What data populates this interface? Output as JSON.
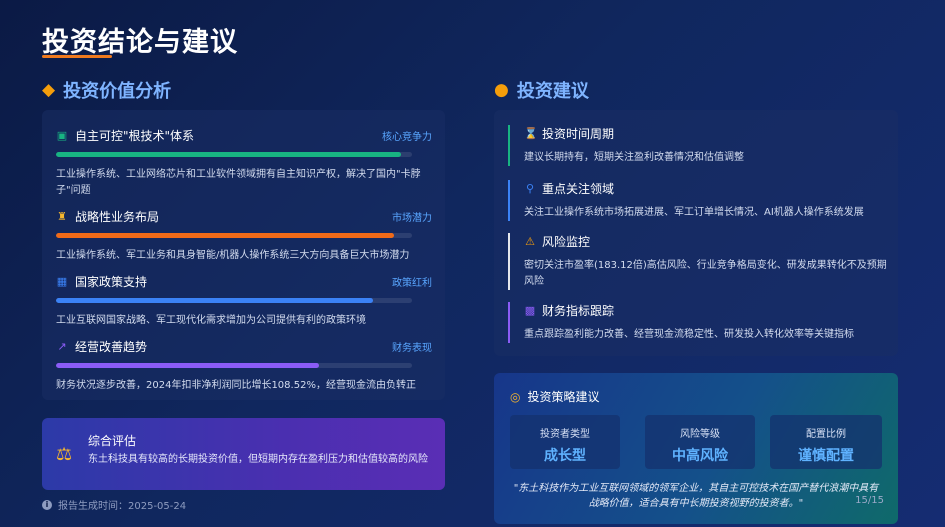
{
  "page": {
    "title": "投资结论与建议",
    "footer": {
      "label": "报告生成时间：",
      "date": "2025-05-24"
    },
    "page_number": "15/15"
  },
  "left": {
    "heading": "投资价值分析",
    "heading_icon": "gem-icon",
    "items": [
      {
        "icon": "chip-icon",
        "title": "自主可控\"根技术\"体系",
        "tag": "核心竞争力",
        "desc": "工业操作系统、工业网络芯片和工业软件领域拥有自主知识产权，解决了国内\"卡脖子\"问题",
        "color": "#18b482",
        "level": 0.97
      },
      {
        "icon": "chess-icon",
        "title": "战略性业务布局",
        "tag": "市场潜力",
        "desc": "工业操作系统、军工业务和具身智能/机器人操作系统三大方向具备巨大市场潜力",
        "color": "#f06a18",
        "level": 0.95
      },
      {
        "icon": "document-icon",
        "title": "国家政策支持",
        "tag": "政策红利",
        "desc": "工业互联网国家战略、军工现代化需求增加为公司提供有利的政策环境",
        "color": "#3b82f6",
        "level": 0.89
      },
      {
        "icon": "trend-chart-icon",
        "title": "经营改善趋势",
        "tag": "财务表现",
        "desc": "财务状况逐步改善，2024年扣非净利润同比增长108.52%，经营现金流由负转正",
        "color": "#8b5cf6",
        "level": 0.74
      }
    ],
    "assessment": {
      "title": "综合评估",
      "text": "东土科技具有较高的长期投资价值，但短期内存在盈利压力和估值较高的风险"
    }
  },
  "right": {
    "heading": "投资建议",
    "heading_icon": "lightbulb-icon",
    "items": [
      {
        "icon": "hourglass-icon",
        "title": "投资时间周期",
        "desc": "建议长期持有，短期关注盈利改善情况和估值调整",
        "color": "#18b482"
      },
      {
        "icon": "search-icon",
        "title": "重点关注领域",
        "desc": "关注工业操作系统市场拓展进展、军工订单增长情况、AI机器人操作系统发展",
        "color": "#3b82f6"
      },
      {
        "icon": "warning-icon",
        "title": "风险监控",
        "desc": "密切关注市盈率(183.12倍)高估风险、行业竞争格局变化、研发成果转化不及预期风险",
        "color": "#e5e7eb"
      },
      {
        "icon": "bar-chart-icon",
        "title": "财务指标跟踪",
        "desc": "重点跟踪盈利能力改善、经营现金流稳定性、研发投入转化效率等关键指标",
        "color": "#8b5cf6"
      }
    ],
    "strategy": {
      "title": "投资策略建议",
      "boxes": [
        {
          "label": "投资者类型",
          "value": "成长型"
        },
        {
          "label": "风险等级",
          "value": "中高风险"
        },
        {
          "label": "配置比例",
          "value": "谨慎配置"
        }
      ],
      "quote": "\"东土科技作为工业互联网领域的领军企业，其自主可控技术在国产替代浪潮中具有战略价值，适合具有中长期投资视野的投资者。\""
    }
  }
}
